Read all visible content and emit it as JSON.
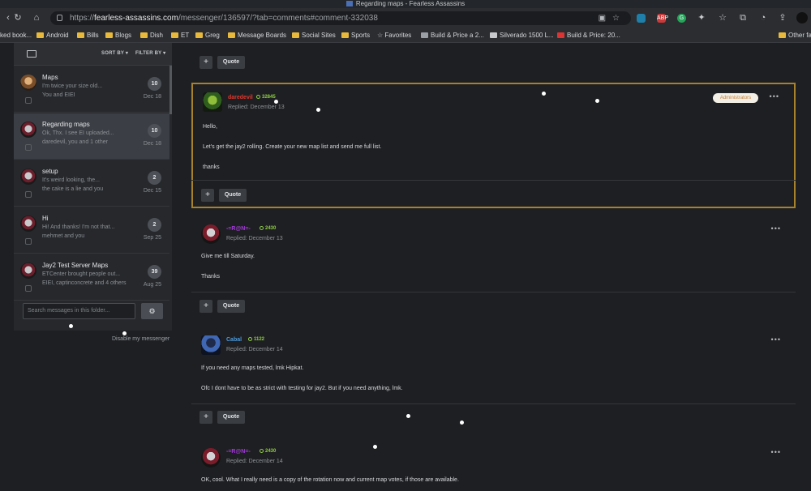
{
  "window": {
    "title": "Regarding maps - Fearless Assassins"
  },
  "urlbar": {
    "scheme": "https://",
    "host": "fearless-assassins.com",
    "path": "/messenger/136597/?tab=comments#comment-332038"
  },
  "bookmarks": [
    "ked book...",
    "Android",
    "Bills",
    "Blogs",
    "Dish",
    "ET",
    "Greg",
    "Message Boards",
    "Social Sites",
    "Sports",
    "Favorites",
    "Build & Price a 2...",
    "Silverado 1500 L...",
    "Build & Price: 20...",
    "Other fa"
  ],
  "extensions": [
    {
      "label": "ABP",
      "color": "#c93a3a"
    },
    {
      "label": "G",
      "color": "#27a35a"
    }
  ],
  "sidebar": {
    "sort_label": "SORT BY ▾",
    "filter_label": "FILTER BY ▾",
    "conversations": [
      {
        "title": "Maps",
        "snippet": "I'm twice your size old...",
        "who": "You and EIEI",
        "count": "10",
        "date": "Dec 18"
      },
      {
        "title": "Regarding maps",
        "snippet": "Ok, Thx. I see EI uploaded...",
        "who": "daredevil, you and 1 other",
        "count": "10",
        "date": "Dec 18"
      },
      {
        "title": "setup",
        "snippet": "It's weird looking, the...",
        "who": "the cake is a lie and you",
        "count": "2",
        "date": "Dec 15"
      },
      {
        "title": "Hi",
        "snippet": "Hi! And thanks! I'm not that...",
        "who": "mehmet and you",
        "count": "2",
        "date": "Sep 25"
      },
      {
        "title": "Jay2 Test Server Maps",
        "snippet": "ETCenter brought people out...",
        "who": "EIEI, captinconcrete and 4 others",
        "count": "39",
        "date": "Aug 25"
      }
    ],
    "search_placeholder": "Search messages in this folder...",
    "disable_label": "Disable my messenger"
  },
  "actions": {
    "quote_label": "Quote",
    "plus_label": "+"
  },
  "posts": [
    {
      "author": "daredevil",
      "author_color": "#e0362c",
      "rep": "32845",
      "date": "Replied: December 13",
      "badge": "Administrators",
      "lines": [
        "Hello,",
        "Let's get the jay2 rolling. Create your new map list and send me full list.",
        "thanks"
      ]
    },
    {
      "author": "-=R@N=-",
      "author_color": "#a23bd8",
      "rep": "2430",
      "date": "Replied: December 13",
      "lines": [
        "Give me till Saturday.",
        "Thanks"
      ]
    },
    {
      "author": "Cabal",
      "author_color": "#4a9be0",
      "rep": "1122",
      "date": "Replied: December 14",
      "lines": [
        "If you need any maps tested, lmk Hipkat.",
        "Ofc I dont have to be as strict with testing for jay2. But if you need anything, lmk."
      ]
    },
    {
      "author": "-=R@N=-",
      "author_color": "#a23bd8",
      "rep": "2430",
      "date": "Replied: December 14",
      "lines": [
        "OK, cool. What I really need is a copy of the rotation now and current map votes, if those are available."
      ]
    }
  ]
}
